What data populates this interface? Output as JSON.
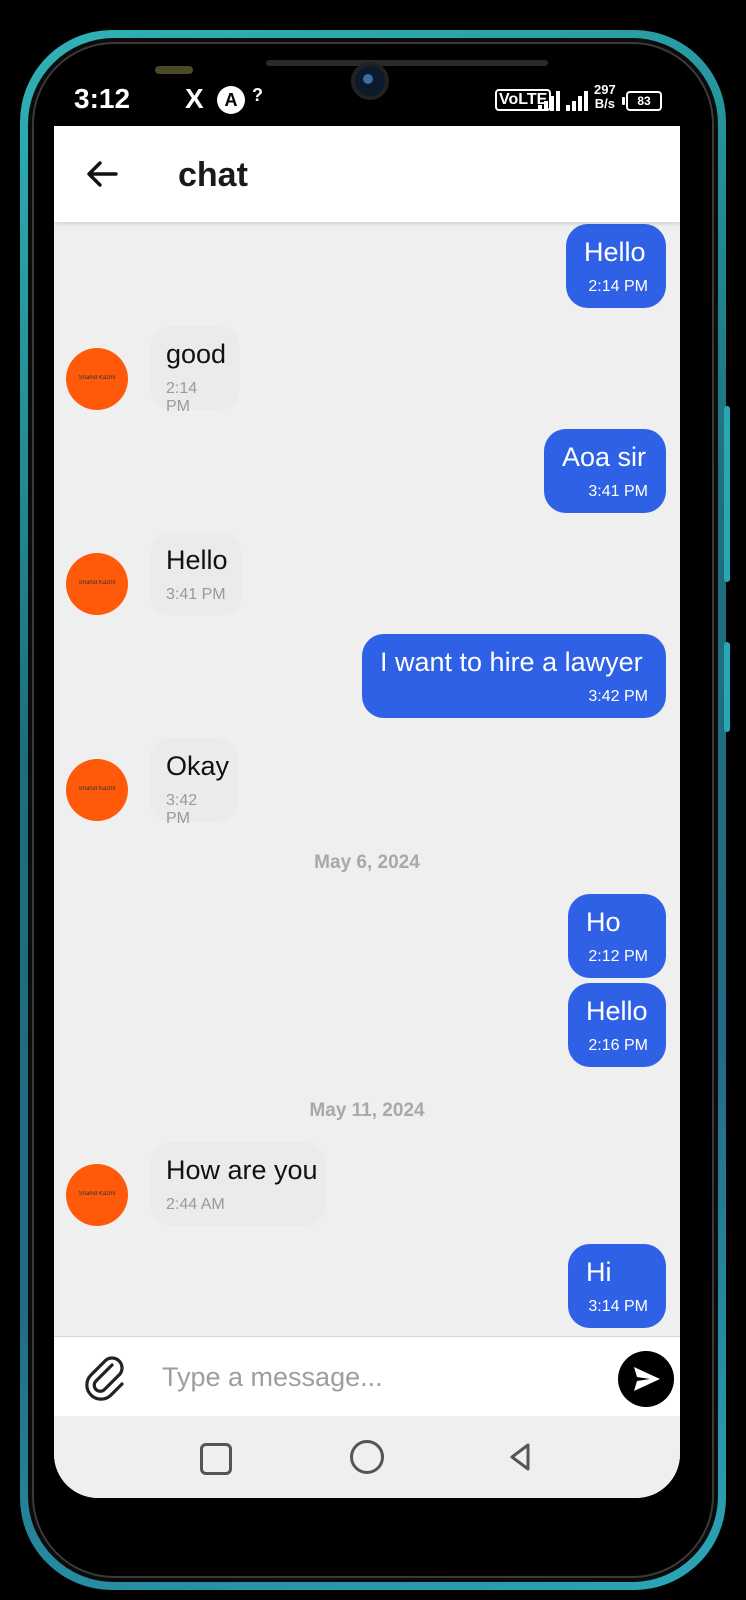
{
  "status_bar": {
    "time": "3:12",
    "x_icon": "X",
    "alert_icon": "A",
    "unknown_signal": "?",
    "volte": "VoLTE",
    "data_speed_value": "297",
    "data_speed_unit": "B/s",
    "battery": "83"
  },
  "header": {
    "title": "chat",
    "back_icon": "arrow-left"
  },
  "messages": [
    {
      "direction": "out",
      "text": "Hello",
      "time": "2:14 PM"
    },
    {
      "direction": "in",
      "text": "good",
      "time": "2:14 PM"
    },
    {
      "direction": "out",
      "text": "Aoa sir",
      "time": "3:41 PM"
    },
    {
      "direction": "in",
      "text": "Hello",
      "time": "3:41 PM"
    },
    {
      "direction": "out",
      "text": "I want to hire a lawyer",
      "time": "3:42 PM"
    },
    {
      "direction": "in",
      "text": "Okay",
      "time": "3:42 PM"
    },
    {
      "type": "date",
      "label": "May 6, 2024"
    },
    {
      "direction": "out",
      "text": "Ho",
      "time": "2:12 PM"
    },
    {
      "direction": "out",
      "text": "Hello",
      "time": "2:16 PM"
    },
    {
      "type": "date",
      "label": "May 11, 2024"
    },
    {
      "direction": "in",
      "text": "How are you",
      "time": "2:44 AM"
    },
    {
      "direction": "out",
      "text": "Hi",
      "time": "3:14 PM"
    }
  ],
  "composer": {
    "placeholder": "Type a message...",
    "attach_icon": "paperclip",
    "send_icon": "send"
  },
  "colors": {
    "outgoing_bubble": "#2f61e6",
    "incoming_bubble": "#ebebeb",
    "avatar": "#ff5a0a",
    "background": "#efefef"
  }
}
